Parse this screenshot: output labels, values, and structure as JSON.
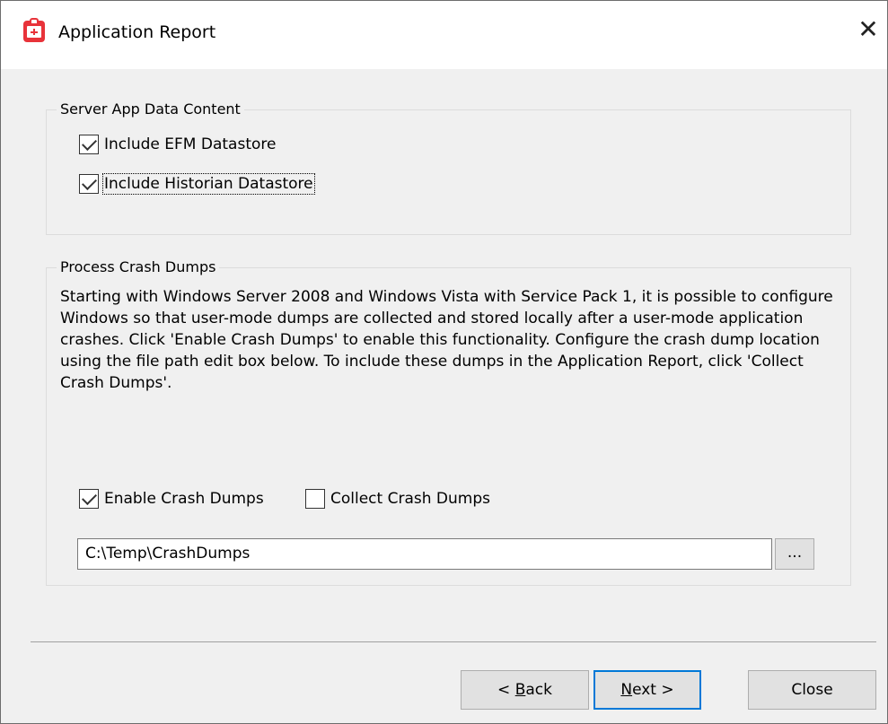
{
  "window": {
    "title": "Application Report",
    "close_glyph": "✕"
  },
  "server_group": {
    "legend": "Server App Data Content",
    "include_efm": {
      "label": "Include EFM Datastore",
      "checked": true
    },
    "include_historian": {
      "label": "Include Historian Datastore",
      "checked": true
    }
  },
  "crash_group": {
    "legend": "Process Crash Dumps",
    "description": "Starting with Windows Server 2008 and Windows Vista with Service Pack 1, it is possible to configure Windows so that user-mode dumps are collected and stored locally after a user-mode application crashes. Click 'Enable Crash Dumps' to enable this functionality. Configure the crash dump location using the file path edit box below. To include these dumps in the Application Report, click 'Collect Crash Dumps'.",
    "enable_crash_dumps": {
      "label": "Enable Crash Dumps",
      "checked": true
    },
    "collect_crash_dumps": {
      "label": "Collect Crash Dumps",
      "checked": false
    },
    "path_value": "C:\\Temp\\CrashDumps",
    "browse_label": "..."
  },
  "buttons": {
    "back_prefix": "< ",
    "back_access": "B",
    "back_rest": "ack",
    "next_access": "N",
    "next_rest": "ext >",
    "close": "Close"
  },
  "colors": {
    "accent": "#0078d7",
    "icon_red": "#e8333a"
  }
}
